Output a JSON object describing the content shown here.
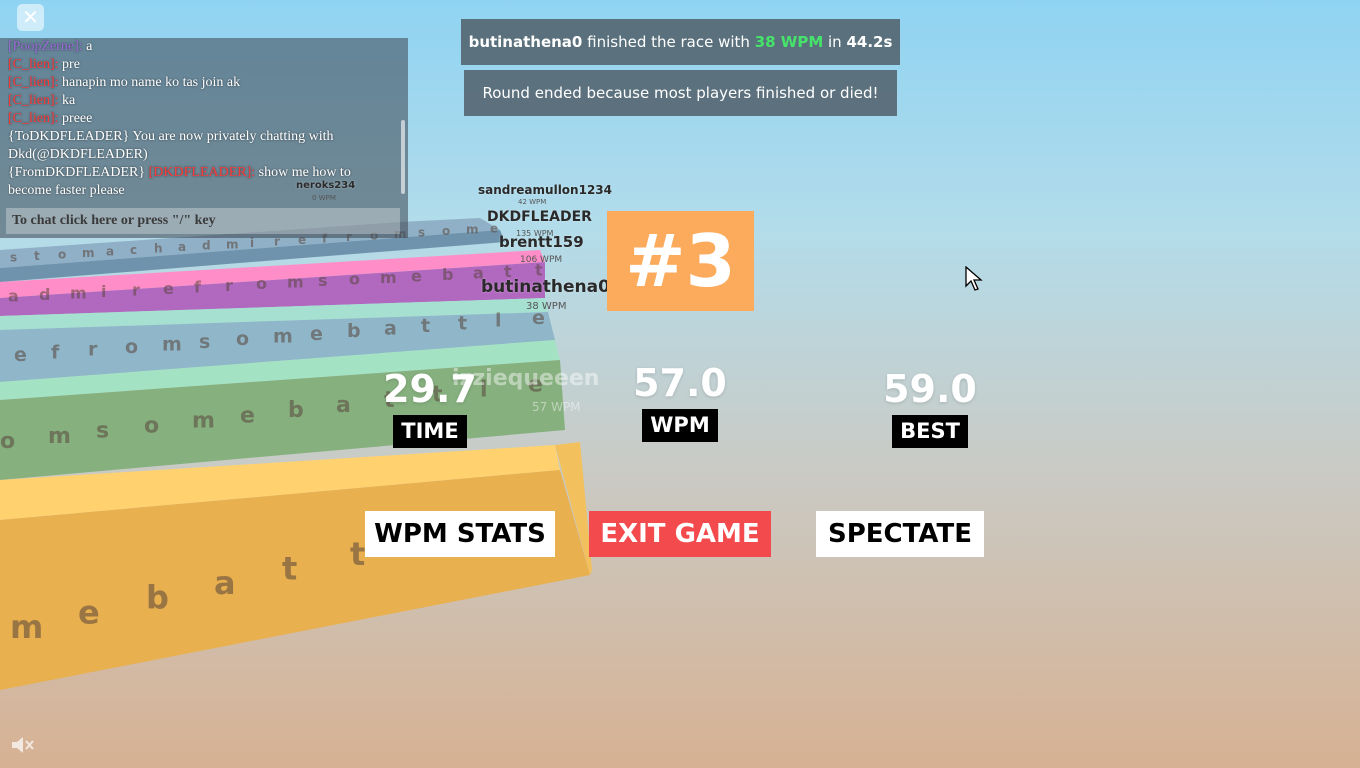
{
  "chat": {
    "lines": [
      {
        "speaker": "[PoopZerne]:",
        "text": " a",
        "speaker_color": "purple"
      },
      {
        "speaker": "[C_lien]:",
        "text": " pre"
      },
      {
        "speaker": "[C_lien]:",
        "text": " hanapin mo name ko tas join ak"
      },
      {
        "speaker": "[C_lien]:",
        "text": " ka"
      },
      {
        "speaker": "[C_lien]:",
        "text": " preee"
      },
      {
        "prefix": "{ToDKDFLEADER}",
        "text": " You are now privately chatting with Dkd(@DKDFLEADER)"
      },
      {
        "prefix": "{FromDKDFLEADER}",
        "speaker": " [DKDFLEADER]:",
        "text": "  show me how to become faster please"
      }
    ],
    "input_placeholder": "To chat click here or press \"/\" key"
  },
  "notices": {
    "finish": {
      "player": "butinathena0",
      "mid": " finished the race with ",
      "wpm": "38 WPM",
      "in": " in ",
      "time": "44.2s"
    },
    "round_ended": "Round ended because most players finished or died!"
  },
  "nametags": [
    {
      "name": "neroks234",
      "wpm": "0 WPM"
    },
    {
      "name": "sandreamullon1234",
      "wpm": "42 WPM"
    },
    {
      "name": "DKDFLEADER",
      "wpm": "135 WPM"
    },
    {
      "name": "brentt159",
      "wpm": "106 WPM"
    },
    {
      "name": "butinathena0",
      "wpm": "38 WPM"
    },
    {
      "name": "izziequeeen",
      "wpm": "57 WPM"
    }
  ],
  "results": {
    "rank": "#3",
    "time": {
      "value": "29.7",
      "label": "TIME"
    },
    "wpm": {
      "value": "57.0",
      "label": "WPM"
    },
    "best": {
      "value": "59.0",
      "label": "BEST"
    }
  },
  "buttons": {
    "wpm_stats": "WPM STATS",
    "exit_game": "EXIT GAME",
    "spectate": "SPECTATE"
  },
  "top_close_glyph": "✕",
  "icons": {
    "close": "close-icon",
    "mute": "speaker-muted-icon",
    "cursor": "mouse-cursor-icon"
  },
  "colors": {
    "rank_bg": "#fcab5c",
    "exit_bg": "#f34a4d",
    "wpm_green": "#45e36a",
    "chat_speaker": "#ff3b3b"
  },
  "track_words": [
    {
      "letters": "stomachadmirefromsome",
      "color": "#8fb0c6"
    },
    {
      "letters": "admirefromsomebattle",
      "color": "#b168bf"
    },
    {
      "letters": "efromsomebattle",
      "color": "#8fb7c9"
    },
    {
      "letters": "omsomebattle",
      "color": "#86b07e"
    },
    {
      "letters": "mebattle",
      "color": "#e8b04f"
    }
  ]
}
